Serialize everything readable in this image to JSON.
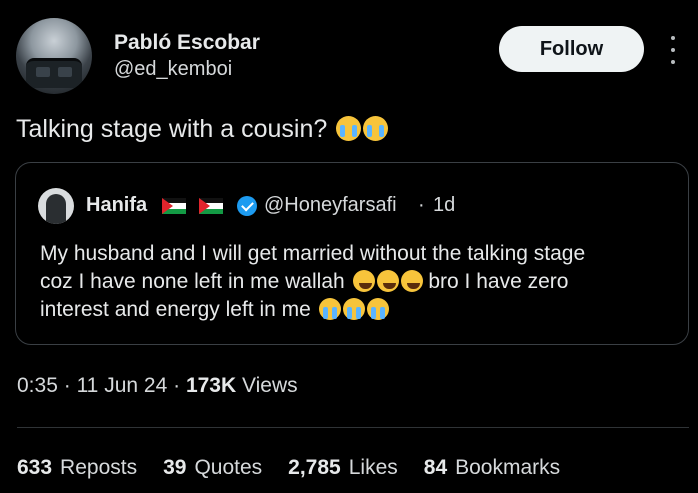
{
  "author": {
    "name": "Pabló Escobar",
    "handle": "@ed_kemboi"
  },
  "follow_label": "Follow",
  "tweet": {
    "text": "Talking stage with a cousin?",
    "emojis": [
      "loudly-crying-face",
      "loudly-crying-face"
    ]
  },
  "quoted": {
    "name": "Hanifa",
    "flags": [
      "palestine-flag",
      "palestine-flag"
    ],
    "verified": true,
    "handle": "@Honeyfarsafi",
    "separator": "·",
    "time": "1d",
    "text_line1": "My husband and I will get married without the talking stage",
    "text_line2a": "coz I have none left in me wallah",
    "text_line2b": "bro I have zero",
    "text_line3": "interest and energy left in me"
  },
  "meta": {
    "time": "0:35",
    "sep1": "·",
    "date": "11 Jun 24",
    "sep2": "·",
    "views_count": "173K",
    "views_label": "Views"
  },
  "stats": [
    {
      "count": "633",
      "label": "Reposts"
    },
    {
      "count": "39",
      "label": "Quotes"
    },
    {
      "count": "2,785",
      "label": "Likes"
    },
    {
      "count": "84",
      "label": "Bookmarks"
    }
  ],
  "colors": {
    "background": "#000000",
    "text": "#e7e9ea",
    "verified": "#1d9bf0",
    "follow_bg": "#eff3f4"
  }
}
